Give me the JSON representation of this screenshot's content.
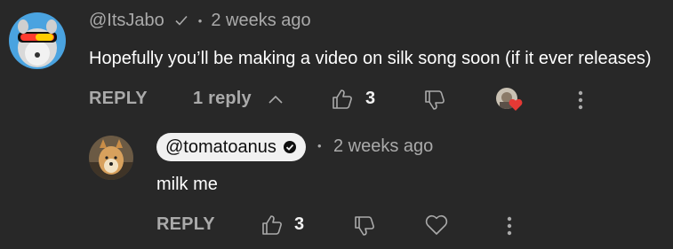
{
  "comment": {
    "author": "@ItsJabo",
    "separator": "•",
    "time": "2 weeks ago",
    "text": "Hopefully you’ll be making a video on silk song soon (if it ever releases)",
    "reply_label": "REPLY",
    "replies_label": "1 reply",
    "like_count": "3",
    "icons": [
      "verified-check-icon",
      "chevron-up-icon",
      "thumbs-up-icon",
      "thumbs-down-icon",
      "creator-heart-icon",
      "more-vertical-icon"
    ]
  },
  "reply": {
    "author": "@tomatoanus",
    "separator": "•",
    "time": "2 weeks ago",
    "text": "milk me",
    "reply_label": "REPLY",
    "like_count": "3",
    "icons": [
      "verified-badge-icon",
      "thumbs-up-icon",
      "thumbs-down-icon",
      "heart-icon",
      "more-vertical-icon"
    ]
  },
  "colors": {
    "background": "#282828",
    "primary_text": "#ffffff",
    "secondary_text": "#aaaaaa",
    "pill_bg": "#f1f1f1",
    "heart": "#e53935"
  }
}
